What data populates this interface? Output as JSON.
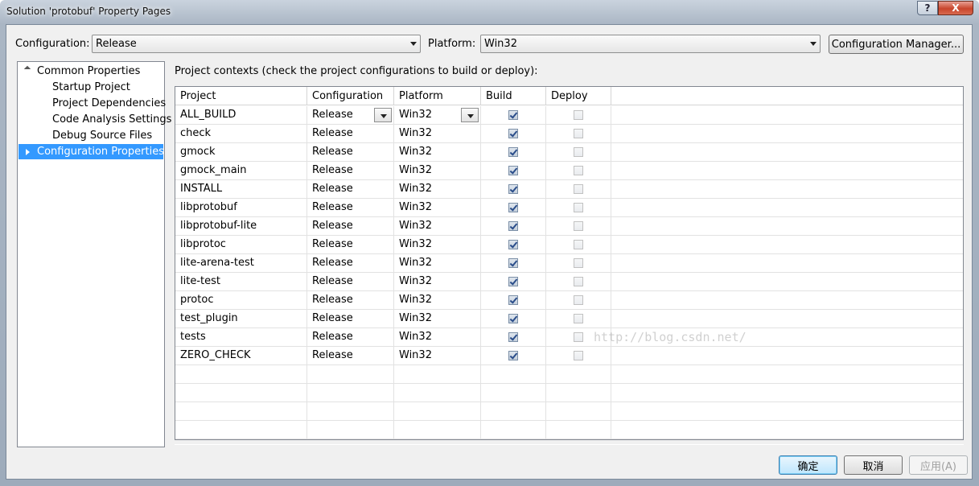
{
  "window": {
    "title": "Solution 'protobuf' Property Pages",
    "help_glyph": "?",
    "close_glyph": "X"
  },
  "config_bar": {
    "configuration_label": "Configuration:",
    "configuration_value": "Release",
    "platform_label": "Platform:",
    "platform_value": "Win32",
    "config_manager_label": "Configuration Manager..."
  },
  "tree": {
    "items": [
      {
        "label": "Common Properties"
      },
      {
        "label": "Startup Project"
      },
      {
        "label": "Project Dependencies"
      },
      {
        "label": "Code Analysis Settings"
      },
      {
        "label": "Debug Source Files"
      },
      {
        "label": "Configuration Properties"
      }
    ]
  },
  "contexts_label": "Project contexts (check the project configurations to build or deploy):",
  "grid": {
    "headers": [
      "Project",
      "Configuration",
      "Platform",
      "Build",
      "Deploy"
    ],
    "rows": [
      {
        "project": "ALL_BUILD",
        "configuration": "Release",
        "platform": "Win32",
        "build": true,
        "deploy": false
      },
      {
        "project": "check",
        "configuration": "Release",
        "platform": "Win32",
        "build": true,
        "deploy": false
      },
      {
        "project": "gmock",
        "configuration": "Release",
        "platform": "Win32",
        "build": true,
        "deploy": false
      },
      {
        "project": "gmock_main",
        "configuration": "Release",
        "platform": "Win32",
        "build": true,
        "deploy": false
      },
      {
        "project": "INSTALL",
        "configuration": "Release",
        "platform": "Win32",
        "build": true,
        "deploy": false
      },
      {
        "project": "libprotobuf",
        "configuration": "Release",
        "platform": "Win32",
        "build": true,
        "deploy": false
      },
      {
        "project": "libprotobuf-lite",
        "configuration": "Release",
        "platform": "Win32",
        "build": true,
        "deploy": false
      },
      {
        "project": "libprotoc",
        "configuration": "Release",
        "platform": "Win32",
        "build": true,
        "deploy": false
      },
      {
        "project": "lite-arena-test",
        "configuration": "Release",
        "platform": "Win32",
        "build": true,
        "deploy": false
      },
      {
        "project": "lite-test",
        "configuration": "Release",
        "platform": "Win32",
        "build": true,
        "deploy": false
      },
      {
        "project": "protoc",
        "configuration": "Release",
        "platform": "Win32",
        "build": true,
        "deploy": false
      },
      {
        "project": "test_plugin",
        "configuration": "Release",
        "platform": "Win32",
        "build": true,
        "deploy": false
      },
      {
        "project": "tests",
        "configuration": "Release",
        "platform": "Win32",
        "build": true,
        "deploy": false
      },
      {
        "project": "ZERO_CHECK",
        "configuration": "Release",
        "platform": "Win32",
        "build": true,
        "deploy": false
      }
    ]
  },
  "watermark": "http://blog.csdn.net/",
  "footer": {
    "ok_label": "确定",
    "cancel_label": "取消",
    "apply_label": "应用(A)"
  }
}
